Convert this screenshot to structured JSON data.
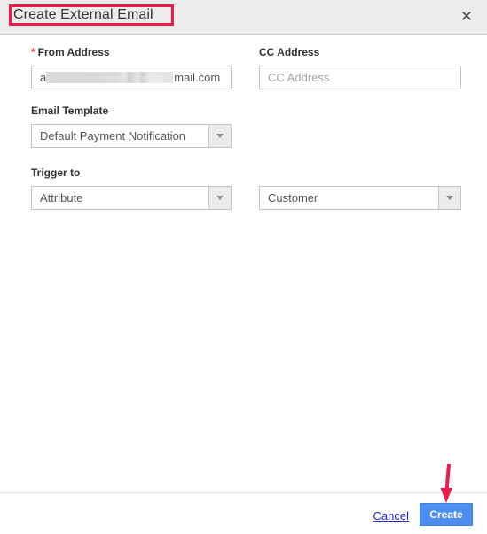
{
  "dialog": {
    "title": "Create External Email",
    "close_icon": "close-x-icon"
  },
  "form": {
    "from_address": {
      "label": "From Address",
      "required_marker": "*",
      "value_prefix": "a",
      "value_suffix": "mail.com",
      "redacted": true
    },
    "cc_address": {
      "label": "CC Address",
      "value": "",
      "placeholder": "CC Address"
    },
    "email_template": {
      "label": "Email Template",
      "selected": "Default Payment Notification",
      "caret_icon": "chevron-down-icon"
    },
    "trigger_to": {
      "label": "Trigger to",
      "selected_left": "Attribute",
      "selected_right": "Customer",
      "caret_icon": "chevron-down-icon"
    }
  },
  "footer": {
    "cancel_label": "Cancel",
    "create_label": "Create"
  },
  "annotations": {
    "title_box_color": "#ef1a4c",
    "arrow_color": "#ef1a4c",
    "arrow_target": "Create"
  },
  "colors": {
    "header_bg": "#ececec",
    "body_bg": "#ffffff",
    "primary_button": "#4e8ef2",
    "link": "#2424d8",
    "required": "#e02b27",
    "border": "#c2c2c2"
  }
}
